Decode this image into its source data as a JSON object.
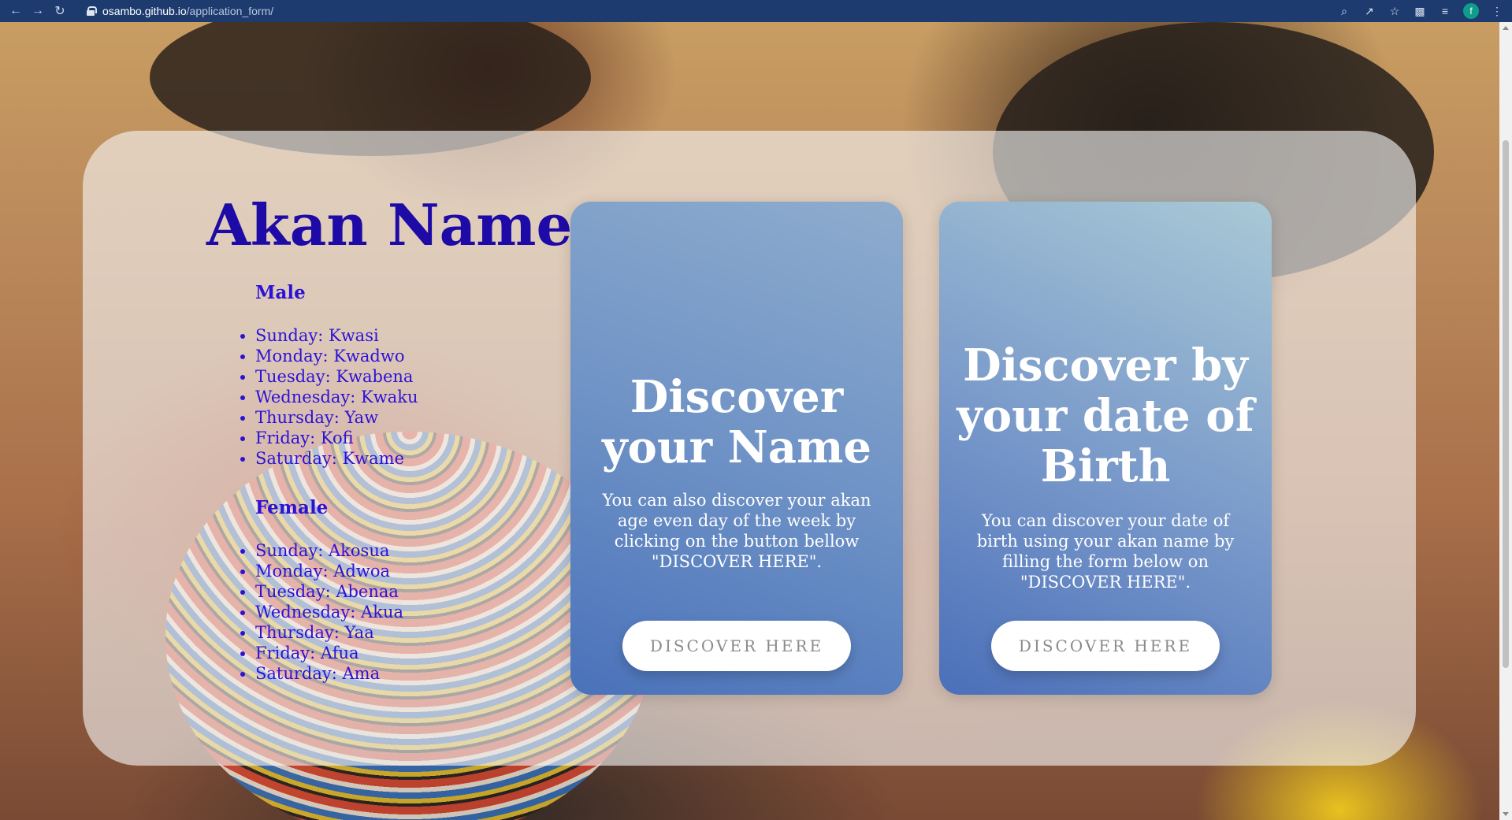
{
  "browser": {
    "url_host": "osambo.github.io",
    "url_path": "/application_form/",
    "profile_initial": "f"
  },
  "intro": {
    "title": "Akan Names",
    "male_heading": "Male",
    "male_names": [
      "Sunday: Kwasi",
      "Monday: Kwadwo",
      "Tuesday: Kwabena",
      "Wednesday: Kwaku",
      "Thursday: Yaw",
      "Friday: Kofi",
      "Saturday: Kwame"
    ],
    "female_heading": "Female",
    "female_names": [
      "Sunday: Akosua",
      "Monday: Adwoa",
      "Tuesday: Abenaa",
      "Wednesday: Akua",
      "Thursday: Yaa",
      "Friday: Afua",
      "Saturday: Ama"
    ]
  },
  "cards": [
    {
      "title": "Discover your Name",
      "text": "You can also discover your akan age even day of the week by clicking on the button bellow \"DISCOVER HERE\".",
      "button": "DISCOVER HERE"
    },
    {
      "title": "Discover by your date of Birth",
      "text": "You can discover your date of birth using your akan name by filling the form below on \"DISCOVER HERE\".",
      "button": "DISCOVER HERE"
    }
  ],
  "colors": {
    "chrome": "#1d3b6f",
    "title": "#1e0aa6",
    "list": "#2c12d6",
    "card_bottom": "#4a72ba",
    "card_top": "#a7c7d7"
  }
}
